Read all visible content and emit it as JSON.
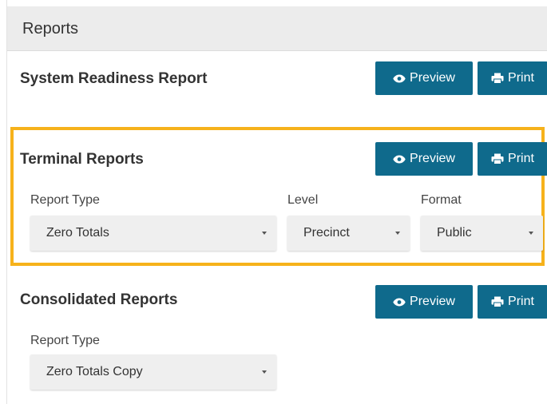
{
  "header": {
    "title": "Reports"
  },
  "buttons": {
    "preview_label": "Preview",
    "print_label": "Print"
  },
  "sections": {
    "system_readiness": {
      "title": "System Readiness Report"
    },
    "terminal": {
      "title": "Terminal Reports",
      "report_type_label": "Report Type",
      "report_type_value": "Zero Totals",
      "level_label": "Level",
      "level_value": "Precinct",
      "format_label": "Format",
      "format_value": "Public"
    },
    "consolidated": {
      "title": "Consolidated Reports",
      "report_type_label": "Report Type",
      "report_type_value": "Zero Totals Copy"
    }
  },
  "colors": {
    "button": "#0f6a8c",
    "highlight": "#f6b21b",
    "header_bg": "#ececec"
  },
  "icons": {
    "preview": "eye-icon",
    "print": "printer-icon",
    "dropdown": "caret-down-icon"
  }
}
